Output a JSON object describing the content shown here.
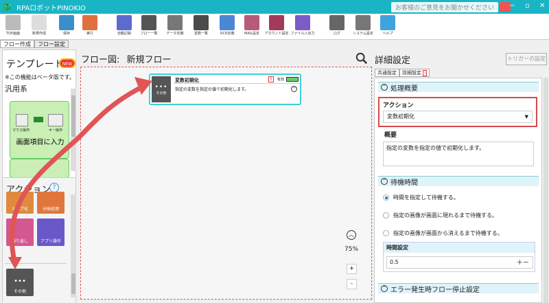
{
  "app": {
    "title": "RPAロボットPINOKIO",
    "feedback": "お客様のご意見をお聞かせください",
    "controls": [
      "−",
      "▫",
      "✕"
    ]
  },
  "toolbar": [
    {
      "label": "TOP画面",
      "color": "#bbb",
      "icon": "home-icon"
    },
    {
      "label": "新規作成",
      "color": "#ddd",
      "icon": "new-file-icon"
    },
    {
      "label": "保存",
      "color": "#3b8fc9",
      "icon": "save-icon"
    },
    {
      "label": "実行",
      "color": "#e07040",
      "icon": "run-icon"
    },
    {
      "label": "自動記録",
      "color": "#5b6bd0",
      "icon": "record-icon"
    },
    {
      "label": "フロー一覧",
      "color": "#555",
      "icon": "flow-list-icon"
    },
    {
      "label": "データ定義",
      "color": "#777",
      "icon": "database-icon"
    },
    {
      "label": "変数一覧",
      "color": "#4a4a4a",
      "icon": "variable-icon"
    },
    {
      "label": "OCR定義",
      "color": "#4b87d4",
      "icon": "ocr-icon"
    },
    {
      "label": "MAIL設定",
      "color": "#b75b78",
      "icon": "mail-icon"
    },
    {
      "label": "アカウント設定",
      "color": "#a33a5a",
      "icon": "account-icon"
    },
    {
      "label": "ファイル入出力",
      "color": "#7c5cc7",
      "icon": "file-io-icon"
    },
    {
      "label": "ログ",
      "color": "#666",
      "icon": "log-icon"
    },
    {
      "label": "システム設定",
      "color": "#777",
      "icon": "gear-icon"
    },
    {
      "label": "ヘルプ",
      "color": "#3ea3df",
      "icon": "help-icon"
    }
  ],
  "tabs": [
    "フロー作成",
    "フロー設定"
  ],
  "left": {
    "template_title": "テンプレート",
    "new_badge": "NEW",
    "beta_note": "※この機能はベータ版です。",
    "category": "汎用系",
    "card1_label": "画面項目に入力",
    "card1_left_icon": "マウス操作",
    "card1_right_icon": "キー操作",
    "actions_title": "アクション",
    "help": "?",
    "tiles": [
      {
        "label": "ループ化",
        "color": "#e08a3e"
      },
      {
        "label": "分岐処理",
        "color": "#e0763e"
      },
      {
        "label": "繰り返し",
        "color": "#d4588f"
      },
      {
        "label": "アプリ操作",
        "color": "#6a58c8"
      },
      {
        "label": "その他",
        "color": "#555"
      }
    ]
  },
  "flow": {
    "header": "フロー図:",
    "name": "新規フロー",
    "node": {
      "title": "変数初期化",
      "desc": "指定の変数を指定の値で初期化します。",
      "status": "有効",
      "icon_label": "その他",
      "warn": "!"
    },
    "zoom": "75%",
    "plus": "+",
    "minus": "-",
    "chev_up": "︿",
    "chev_down": "﹀"
  },
  "right": {
    "title": "詳細設定",
    "trigger": "トリガーの設定",
    "tabs": [
      "共通設定",
      "詳細設定"
    ],
    "warn": "!",
    "section1": "処理概要",
    "action_label": "アクション",
    "action_value": "変数初期化",
    "summary_label": "概要",
    "summary_value": "指定の変数を指定の値で初期化します。",
    "section2": "待機時間",
    "radios": [
      {
        "label": "時間を指定して待機する。",
        "checked": true
      },
      {
        "label": "指定の画像が画面に現れるまで待機する。",
        "checked": false
      },
      {
        "label": "指定の画像が画面から消えるまで待機する。",
        "checked": false
      }
    ],
    "time_label": "時間設定",
    "time_value": "0.5",
    "pm": "+−",
    "section3": "エラー発生時フロー停止設定",
    "collapse": "^"
  },
  "colors": {
    "accent": "#19b5c5",
    "arrow": "#e05555"
  }
}
